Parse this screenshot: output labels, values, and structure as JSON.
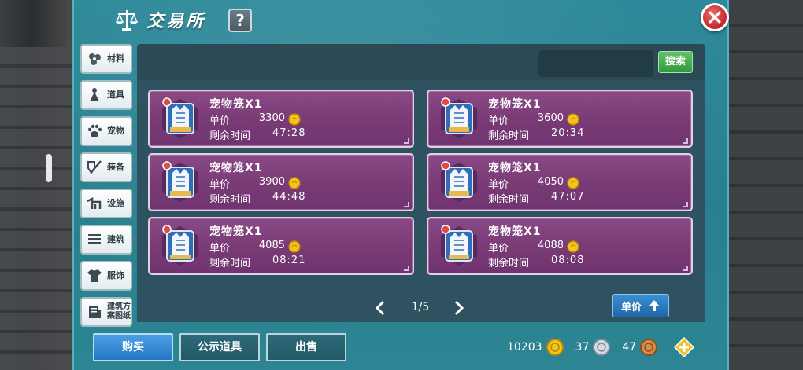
{
  "window": {
    "title": "交易所",
    "help_label": "?"
  },
  "sidebar": {
    "items": [
      {
        "label": "材料",
        "icon": "flower-icon"
      },
      {
        "label": "道具",
        "icon": "cone-icon"
      },
      {
        "label": "宠物",
        "icon": "paw-icon"
      },
      {
        "label": "装备",
        "icon": "sword-icon"
      },
      {
        "label": "设施",
        "icon": "horse-icon"
      },
      {
        "label": "建筑",
        "icon": "brick-wall-icon"
      },
      {
        "label": "服饰",
        "icon": "shirt-icon"
      },
      {
        "label": "建筑方案图纸",
        "icon": "blueprint-icon"
      }
    ]
  },
  "search": {
    "placeholder": "",
    "button_label": "搜索"
  },
  "listings": {
    "price_label": "单价",
    "time_label": "剩余时间",
    "items": [
      {
        "name": "宠物笼X1",
        "price": "3300",
        "time": "47:28"
      },
      {
        "name": "宠物笼X1",
        "price": "3600",
        "time": "20:34"
      },
      {
        "name": "宠物笼X1",
        "price": "3900",
        "time": "44:48"
      },
      {
        "name": "宠物笼X1",
        "price": "4050",
        "time": "47:07"
      },
      {
        "name": "宠物笼X1",
        "price": "4085",
        "time": "08:21"
      },
      {
        "name": "宠物笼X1",
        "price": "4088",
        "time": "08:08"
      }
    ]
  },
  "pagination": {
    "page_text": "1/5"
  },
  "sort": {
    "label": "单价"
  },
  "tabs": [
    {
      "label": "购买",
      "active": true
    },
    {
      "label": "公示道具",
      "active": false
    },
    {
      "label": "出售",
      "active": false
    }
  ],
  "currency": {
    "gold": "10203",
    "silver": "37",
    "bronze": "47"
  },
  "colors": {
    "panel": "#2a7f8e",
    "card": "#7a3b76",
    "accent_green": "#2f9a3a",
    "accent_blue": "#2476c4",
    "close_red": "#c1272d"
  }
}
